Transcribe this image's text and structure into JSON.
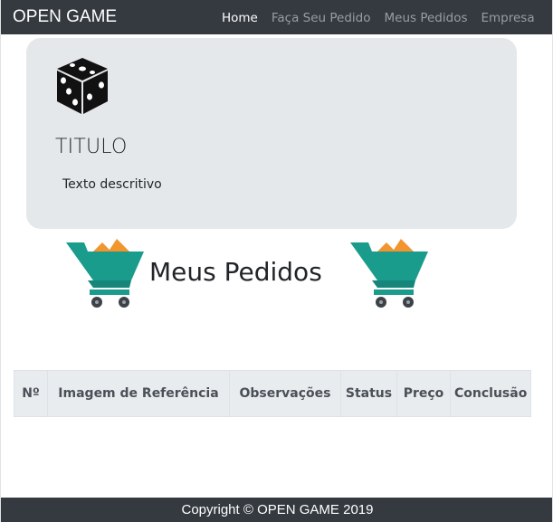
{
  "navbar": {
    "brand": "OPEN GAME",
    "links": [
      {
        "label": "Home",
        "active": true
      },
      {
        "label": "Faça Seu Pedido",
        "active": false
      },
      {
        "label": "Meus Pedidos",
        "active": false
      },
      {
        "label": "Empresa",
        "active": false
      }
    ]
  },
  "card": {
    "icon": "dice-icon",
    "title": "TITULO",
    "text": "Texto descritivo"
  },
  "heading": {
    "title": "Meus Pedidos",
    "icon": "shopping-cart-icon"
  },
  "table": {
    "headers": [
      "Nº",
      "Imagem de Referência",
      "Observações",
      "Status",
      "Preço",
      "Conclusão"
    ],
    "rows": []
  },
  "footer": {
    "text": "Copyright © OPEN GAME 2019"
  },
  "colors": {
    "navbar_bg": "#343a40",
    "card_bg": "#e5e8eb",
    "cart_teal": "#1a9c8c",
    "cart_orange": "#f2952f",
    "table_header_bg": "#e9ecef"
  }
}
